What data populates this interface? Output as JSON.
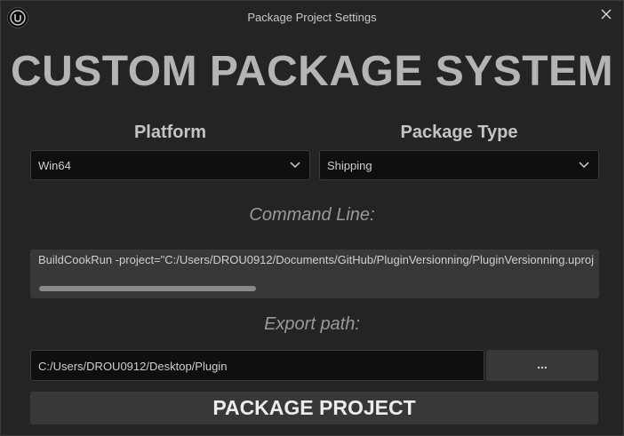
{
  "window": {
    "title": "Package Project Settings",
    "logo_icon": "unreal-engine-logo-icon",
    "close_icon": "close-icon"
  },
  "headline": "CUSTOM PACKAGE SYSTEM",
  "platform": {
    "label": "Platform",
    "selected": "Win64",
    "dropdown_icon": "chevron-down-icon"
  },
  "package_type": {
    "label": "Package Type",
    "selected": "Shipping",
    "dropdown_icon": "chevron-down-icon"
  },
  "command_line": {
    "label": "Command Line:",
    "value": "BuildCookRun -project=\"C:/Users/DROU0912/Documents/GitHub/PluginVersionning/PluginVersionning.uproj"
  },
  "export_path": {
    "label": "Export path:",
    "value": "C:/Users/DROU0912/Desktop/Plugin",
    "browse_label": "..."
  },
  "package_button": "PACKAGE PROJECT",
  "colors": {
    "window_bg": "#242424",
    "field_bg": "#0f0f0f",
    "button_bg": "#383838",
    "headline": "#b4b4b4"
  }
}
